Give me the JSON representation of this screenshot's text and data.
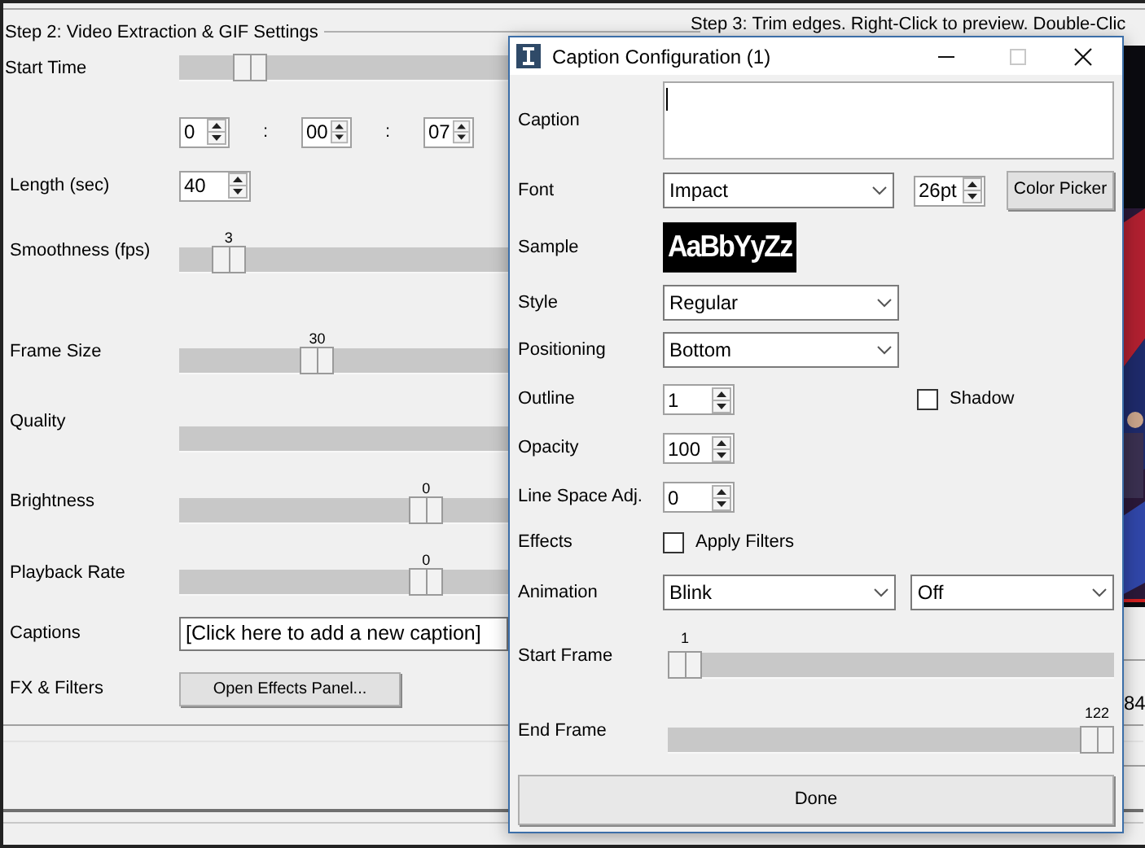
{
  "main": {
    "section_title": "Step 2: Video Extraction & GIF Settings",
    "step3_title": "Step 3: Trim edges. Right-Click to preview. Double-Clic",
    "side_number": "84",
    "rows": [
      {
        "kind": "slider",
        "label": "Start Time",
        "level": 0.18
      },
      {
        "kind": "time",
        "fields": [
          "0",
          "00",
          "07"
        ],
        "separators": [
          ":",
          ":"
        ]
      },
      {
        "kind": "spinner",
        "label": "Length (sec)",
        "value": "40"
      },
      {
        "kind": "slider",
        "label": "Smoothness (fps)",
        "value": "3",
        "level": 0.11
      },
      {
        "kind": "slider",
        "label": "Frame Size",
        "value": "30",
        "level": 0.41
      },
      {
        "kind": "slider",
        "label": "Quality"
      },
      {
        "kind": "slider",
        "label": "Brightness",
        "value": "0",
        "level": 0.78
      },
      {
        "kind": "slider",
        "label": "Playback Rate",
        "value": "0",
        "level": 0.78
      },
      {
        "kind": "text",
        "label": "Captions",
        "value": "[Click here to add a new caption]"
      },
      {
        "kind": "button",
        "label": "FX & Filters",
        "button": "Open Effects Panel..."
      }
    ]
  },
  "dialog": {
    "title": "Caption Configuration (1)",
    "fields": [
      {
        "kind": "textarea",
        "label": "Caption"
      },
      {
        "kind": "font",
        "label": "Font",
        "value": "Impact",
        "size": "26pt",
        "button": "Color Picker"
      },
      {
        "kind": "sample",
        "label": "Sample",
        "text": "AaBbYyZz"
      },
      {
        "kind": "select",
        "label": "Style",
        "value": "Regular"
      },
      {
        "kind": "select",
        "label": "Positioning",
        "value": "Bottom"
      },
      {
        "kind": "spinner",
        "label": "Outline",
        "value": "1",
        "checkbox": {
          "label": "Shadow",
          "checked": false
        }
      },
      {
        "kind": "spinner",
        "label": "Opacity",
        "value": "100"
      },
      {
        "kind": "spinner",
        "label": "Line Space Adj.",
        "value": "0"
      },
      {
        "kind": "checkbox",
        "label": "Effects",
        "checkbox": {
          "label": "Apply Filters",
          "checked": false
        }
      },
      {
        "kind": "select2",
        "label": "Animation",
        "values": [
          "Blink",
          "Off"
        ]
      },
      {
        "kind": "slider",
        "label": "Start Frame",
        "value": "1",
        "level": 0
      },
      {
        "kind": "slider",
        "label": "End Frame",
        "value": "122",
        "level": 1
      }
    ],
    "done": "Done"
  }
}
